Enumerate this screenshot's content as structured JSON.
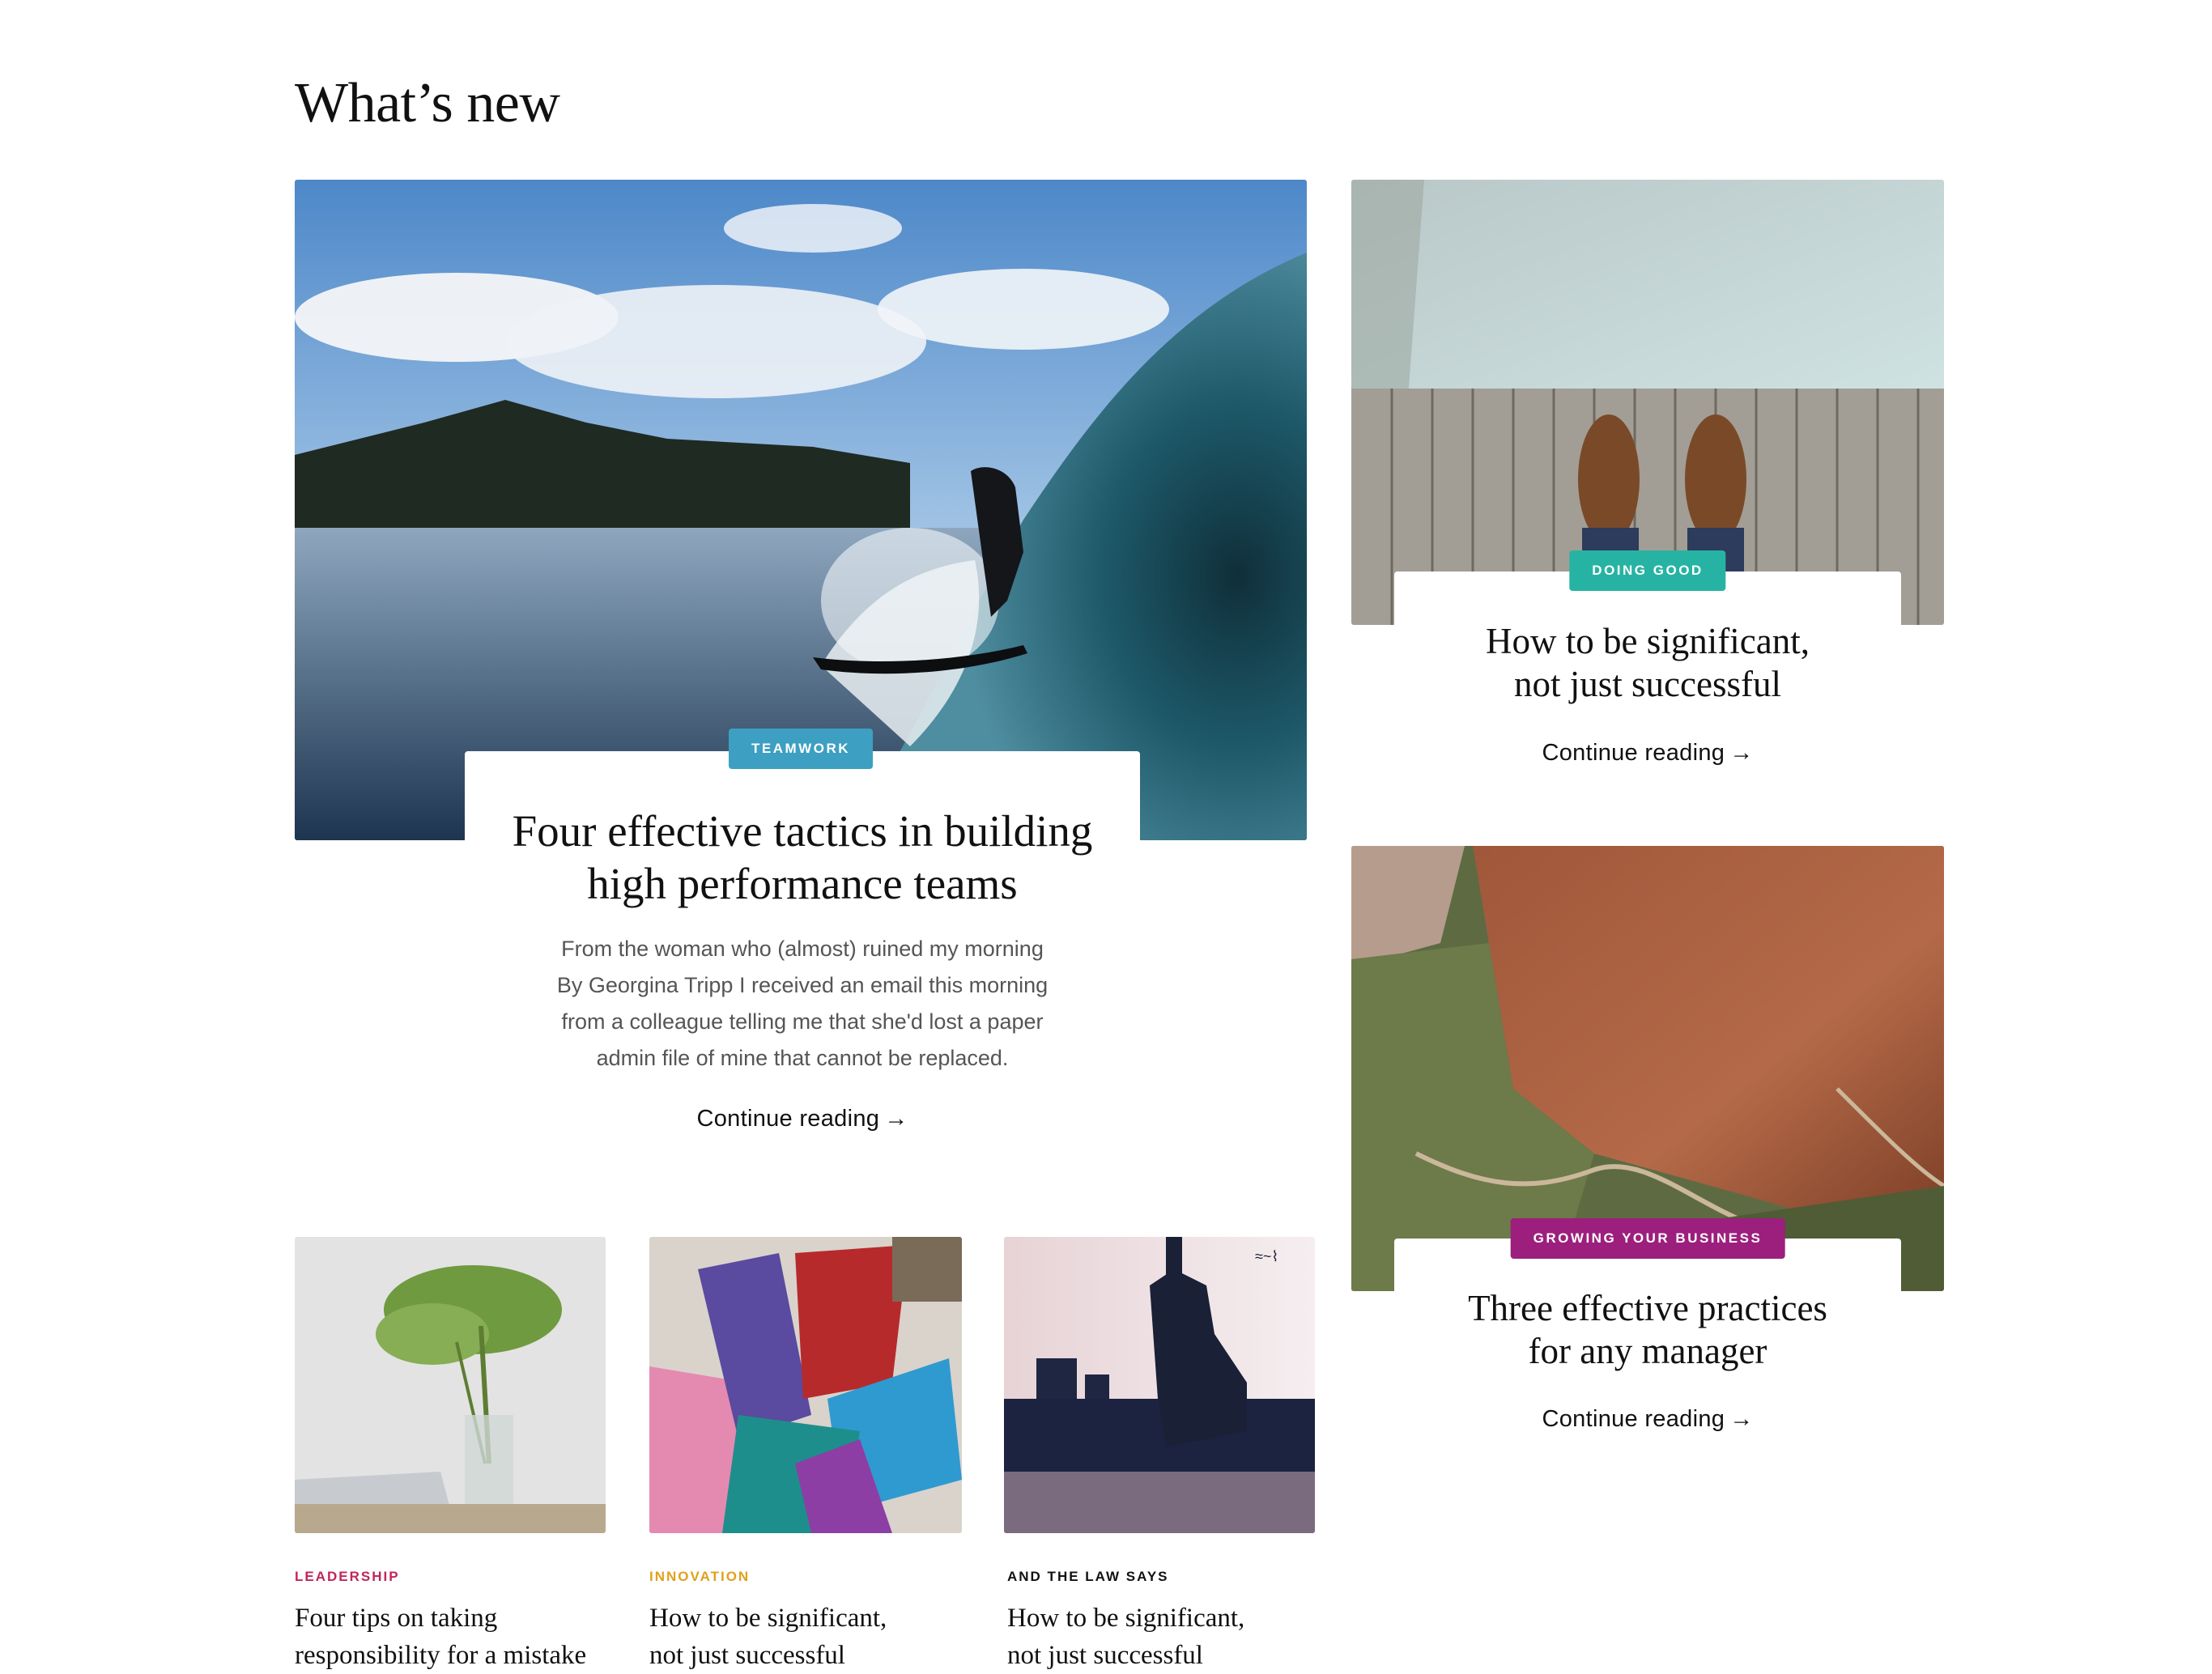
{
  "section": {
    "heading": "What’s new"
  },
  "featured": {
    "category": "TEAMWORK",
    "title_line1": "Four effective tactics in building",
    "title_line2": "high performance teams",
    "excerpt_line1": "From the woman who (almost) ruined my morning",
    "excerpt_line2": "By Georgina Tripp I received an email this morning",
    "excerpt_line3": "from a colleague telling me that she'd lost a paper",
    "excerpt_line4": "admin file of mine that cannot be replaced.",
    "cta": "Continue reading",
    "arrow": "→"
  },
  "side_top": {
    "category": "DOING GOOD",
    "title_line1": "How to be significant,",
    "title_line2": "not just successful",
    "cta": "Continue reading",
    "arrow": "→"
  },
  "side_bottom": {
    "category": "GROWING YOUR BUSINESS",
    "title_line1": "Three effective practices",
    "title_line2": "for any manager",
    "cta": "Continue reading",
    "arrow": "→"
  },
  "small_cards": [
    {
      "category": "LEADERSHIP",
      "title_line1": "Four tips on taking",
      "title_line2": "responsibility for a mistake"
    },
    {
      "category": "INNOVATION",
      "title_line1": "How to be significant,",
      "title_line2": "not just successful"
    },
    {
      "category": "AND THE LAW SAYS",
      "title_line1": "How to be significant,",
      "title_line2": "not just successful"
    }
  ],
  "colors": {
    "teamwork": "#3d9fc2",
    "doing_good": "#27b3a3",
    "growing_business": "#9c1f7d",
    "leadership": "#c0265a",
    "innovation": "#e0a11a",
    "law": "#111111"
  }
}
